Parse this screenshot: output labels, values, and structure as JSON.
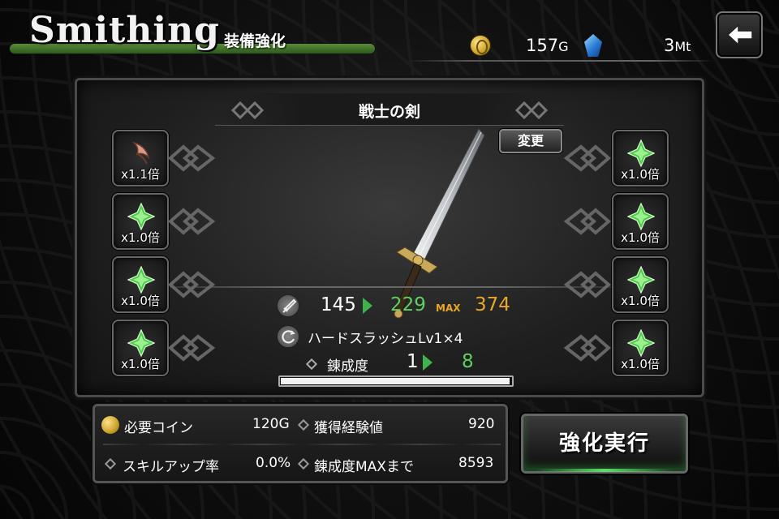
{
  "header": {
    "title": "Smithing",
    "subtitle": "装備強化",
    "coins": "157",
    "coins_unit": "G",
    "gems": "3",
    "gems_unit": "Mt"
  },
  "weapon": {
    "name": "戦士の剣",
    "change_label": "変更",
    "atk_base": "145",
    "atk_new": "229",
    "max_label": "MAX",
    "atk_max": "374",
    "skill": "ハードスラッシュLv1×4",
    "refine_label": "錬成度",
    "refine_current": "1",
    "refine_new": "8",
    "refine_progress": 1.0
  },
  "slots": {
    "left": [
      {
        "mult": "x1.1倍",
        "icon": "claw-material-icon"
      },
      {
        "mult": "x1.0倍",
        "icon": "green-crystal-icon"
      },
      {
        "mult": "x1.0倍",
        "icon": "green-crystal-icon"
      },
      {
        "mult": "x1.0倍",
        "icon": "green-crystal-icon"
      }
    ],
    "right": [
      {
        "mult": "x1.0倍",
        "icon": "green-crystal-icon"
      },
      {
        "mult": "x1.0倍",
        "icon": "green-crystal-icon"
      },
      {
        "mult": "x1.0倍",
        "icon": "green-crystal-icon"
      },
      {
        "mult": "x1.0倍",
        "icon": "green-crystal-icon"
      }
    ]
  },
  "info": {
    "cost_label": "必要コイン",
    "cost_value": "120G",
    "exp_label": "獲得経験値",
    "exp_value": "920",
    "skillup_label": "スキルアップ率",
    "skillup_value": "0.0%",
    "refine_max_label": "錬成度MAXまで",
    "refine_max_value": "8593"
  },
  "action": {
    "execute_label": "強化実行"
  },
  "colors": {
    "accent_green": "#5fcf5f",
    "max_orange": "#e8a826",
    "bar_green": "#4a7a32"
  }
}
